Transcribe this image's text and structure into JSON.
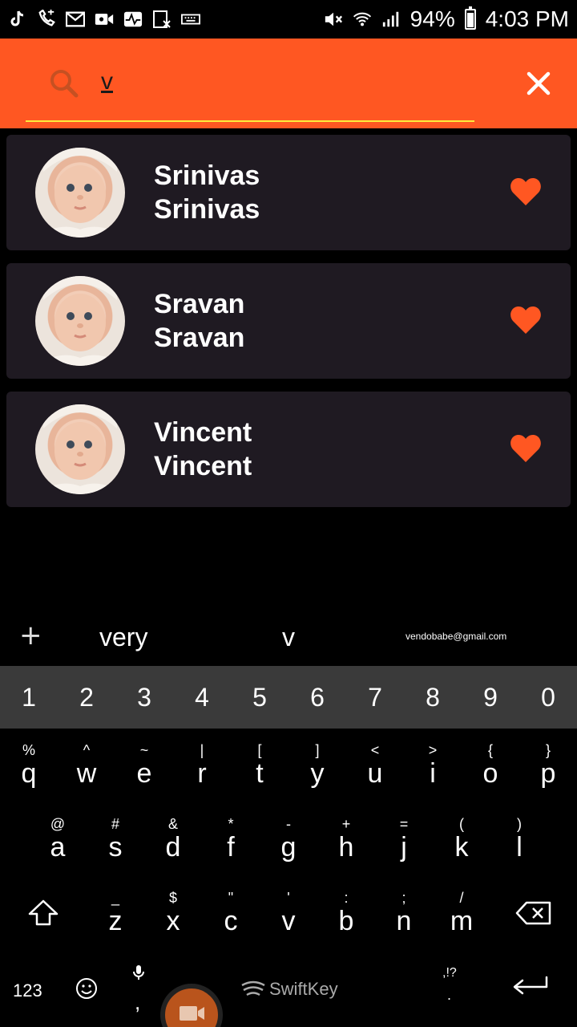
{
  "status": {
    "battery": "94%",
    "time": "4:03 PM",
    "left_icons": [
      "tiktok-icon",
      "call-icon",
      "gmail-icon",
      "video-icon",
      "activity-icon",
      "sim-icon",
      "keyboard-icon"
    ],
    "right_icons": [
      "mute-icon",
      "wifi-icon",
      "signal-icon",
      "battery-icon"
    ]
  },
  "search": {
    "value": "v",
    "accent": "#ff5722",
    "underline_color": "#ffeb3b"
  },
  "results": [
    {
      "name_line1": "Srinivas",
      "name_line2": "Srinivas"
    },
    {
      "name_line1": "Sravan",
      "name_line2": "Sravan"
    },
    {
      "name_line1": "Vincent",
      "name_line2": "Vincent"
    }
  ],
  "keyboard": {
    "suggestions": [
      "very",
      "v",
      "vendobabe@gmail.com"
    ],
    "numbers": [
      "1",
      "2",
      "3",
      "4",
      "5",
      "6",
      "7",
      "8",
      "9",
      "0"
    ],
    "row1": [
      {
        "alt": "%",
        "main": "q"
      },
      {
        "alt": "^",
        "main": "w"
      },
      {
        "alt": "~",
        "main": "e"
      },
      {
        "alt": "|",
        "main": "r"
      },
      {
        "alt": "[",
        "main": "t"
      },
      {
        "alt": "]",
        "main": "y"
      },
      {
        "alt": "<",
        "main": "u"
      },
      {
        "alt": ">",
        "main": "i"
      },
      {
        "alt": "{",
        "main": "o"
      },
      {
        "alt": "}",
        "main": "p"
      }
    ],
    "row2": [
      {
        "alt": "@",
        "main": "a"
      },
      {
        "alt": "#",
        "main": "s"
      },
      {
        "alt": "&",
        "main": "d"
      },
      {
        "alt": "*",
        "main": "f"
      },
      {
        "alt": "-",
        "main": "g"
      },
      {
        "alt": "+",
        "main": "h"
      },
      {
        "alt": "=",
        "main": "j"
      },
      {
        "alt": "(",
        "main": "k"
      },
      {
        "alt": ")",
        "main": "l"
      }
    ],
    "row3": [
      {
        "alt": "_",
        "main": "z"
      },
      {
        "alt": "$",
        "main": "x"
      },
      {
        "alt": "\"",
        "main": "c"
      },
      {
        "alt": "'",
        "main": "v"
      },
      {
        "alt": ":",
        "main": "b"
      },
      {
        "alt": ";",
        "main": "n"
      },
      {
        "alt": "/",
        "main": "m"
      }
    ],
    "key_123": "123",
    "comma": ",",
    "brand": "SwiftKey",
    "punct": ",!?",
    "period": "."
  }
}
